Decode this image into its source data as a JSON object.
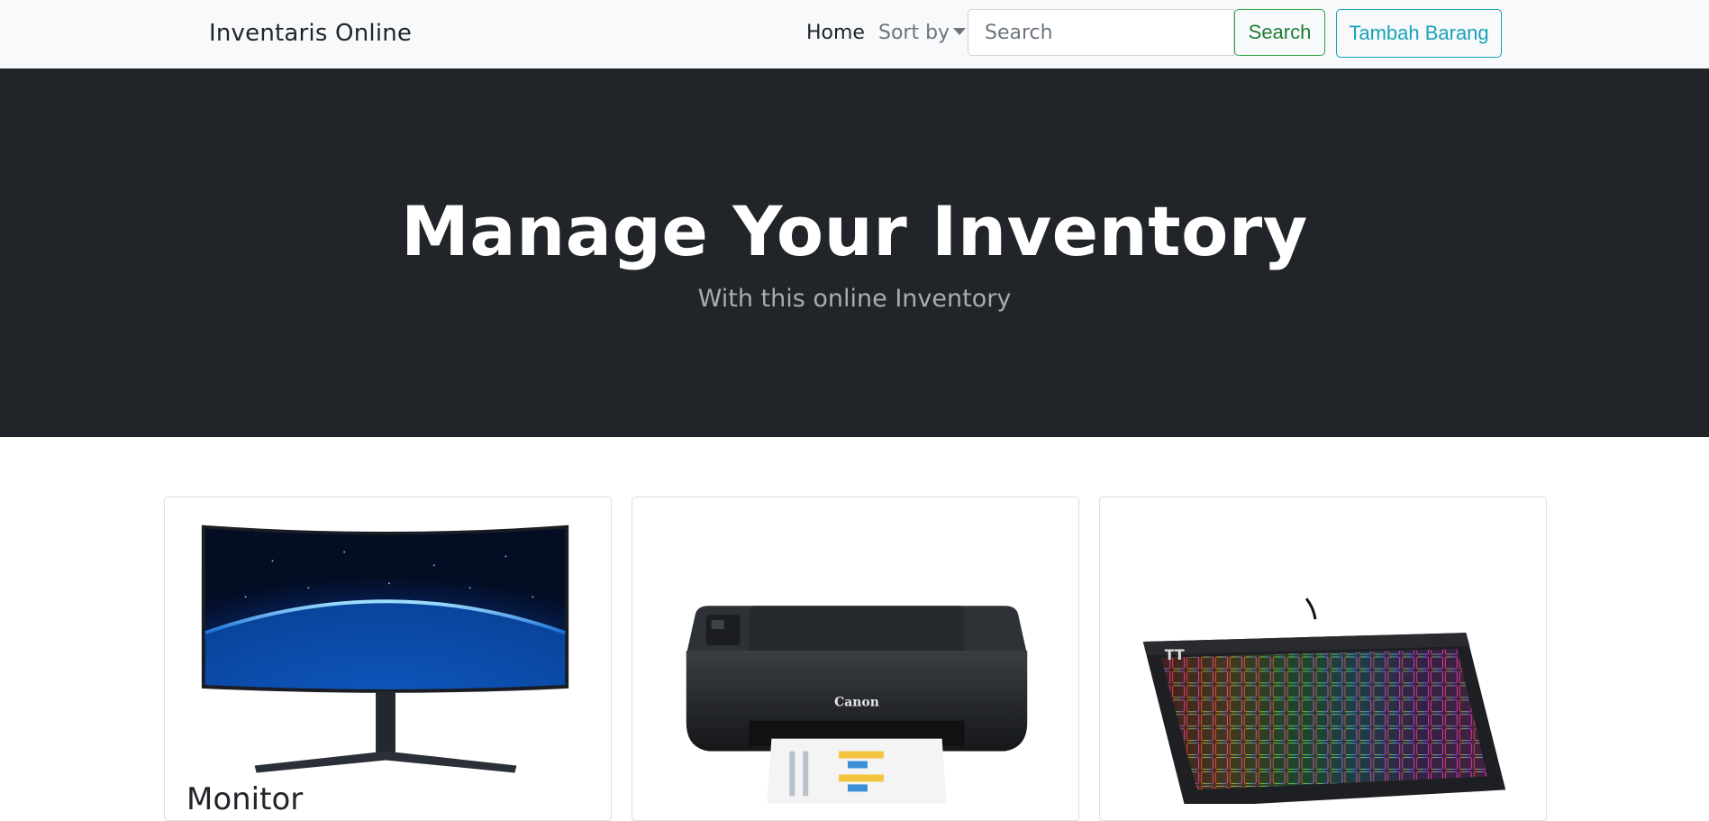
{
  "navbar": {
    "brand": "Inventaris Online",
    "home_label": "Home",
    "sort_label": "Sort by",
    "search_placeholder": "Search",
    "search_button": "Search",
    "add_button": "Tambah Barang"
  },
  "hero": {
    "title": "Manage Your Inventory",
    "subtitle": "With this online Inventory"
  },
  "cards": [
    {
      "title": "Monitor",
      "image": "curved-monitor-image"
    },
    {
      "title": "",
      "image": "printer-image",
      "brand_text": "Canon"
    },
    {
      "title": "",
      "image": "rgb-keyboard-image"
    }
  ],
  "colors": {
    "navbar_bg": "#f8f9fa",
    "hero_bg": "#212529",
    "success": "#28a745",
    "info": "#17a2b8"
  }
}
